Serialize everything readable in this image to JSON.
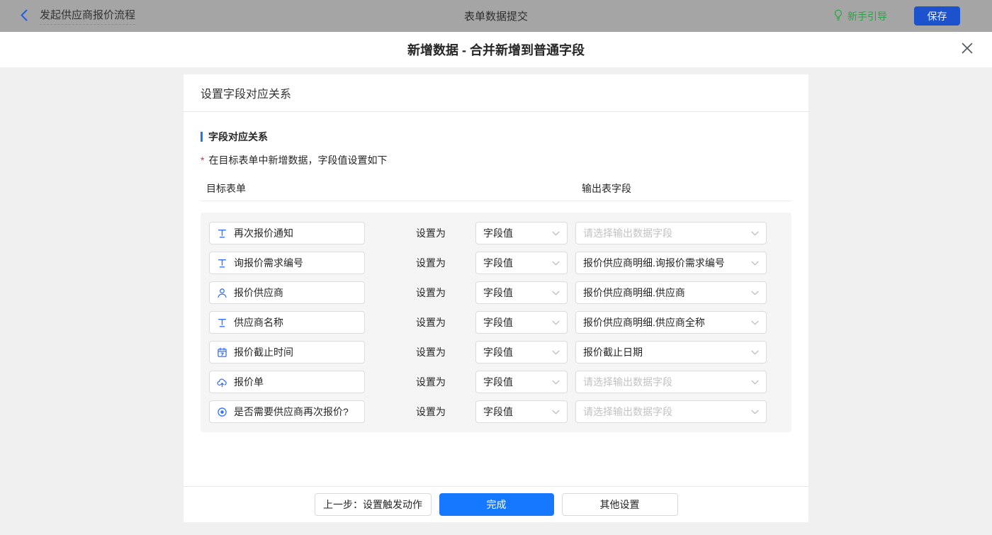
{
  "topbar": {
    "title": "发起供应商报价流程",
    "center_title": "表单数据提交",
    "guide_label": "新手引导",
    "save_label": "保存"
  },
  "modal": {
    "title": "新增数据 - 合并新增到普通字段"
  },
  "card": {
    "header": "设置字段对应关系",
    "section_title": "字段对应关系",
    "required_mark": "*",
    "description": "在目标表单中新增数据，字段值设置如下",
    "col_left": "目标表单",
    "col_right": "输出表字段",
    "set_as_label": "设置为",
    "rows": [
      {
        "icon": "text-input-icon",
        "field": "再次报价通知",
        "type": "字段值",
        "output": "请选择输出数据字段",
        "is_placeholder": true
      },
      {
        "icon": "text-input-icon",
        "field": "询报价需求编号",
        "type": "字段值",
        "output": "报价供应商明细.询报价需求编号",
        "is_placeholder": false
      },
      {
        "icon": "user-icon",
        "field": "报价供应商",
        "type": "字段值",
        "output": "报价供应商明细.供应商",
        "is_placeholder": false
      },
      {
        "icon": "text-input-icon",
        "field": "供应商名称",
        "type": "字段值",
        "output": "报价供应商明细.供应商全称",
        "is_placeholder": false
      },
      {
        "icon": "calendar-icon",
        "field": "报价截止时间",
        "type": "字段值",
        "output": "报价截止日期",
        "is_placeholder": false
      },
      {
        "icon": "cloud-upload-icon",
        "field": "报价单",
        "type": "字段值",
        "output": "请选择输出数据字段",
        "is_placeholder": true
      },
      {
        "icon": "radio-icon",
        "field": "是否需要供应商再次报价?",
        "type": "字段值",
        "output": "请选择输出数据字段",
        "is_placeholder": true
      }
    ],
    "footer": {
      "prev_label": "上一步：设置触发动作",
      "done_label": "完成",
      "other_label": "其他设置"
    }
  },
  "icons": {
    "back-icon": "chevron-left",
    "guide-icon": "lightbulb",
    "close-icon": "x",
    "text-input-icon": "T",
    "user-icon": "person",
    "calendar-icon": "calendar",
    "cloud-upload-icon": "cloud-upload",
    "radio-icon": "radio-selected",
    "chevron-down-icon": "chevron-down"
  },
  "colors": {
    "topbar_bg": "#a5a5a5",
    "primary_blue": "#1677ff",
    "save_button_blue": "#1c52cd",
    "guide_green": "#2aa344",
    "field_icon_blue": "#3370ff",
    "required_red": "#f5222d",
    "panel_bg": "#f5f5f5",
    "placeholder_gray": "#c2c2c2"
  }
}
